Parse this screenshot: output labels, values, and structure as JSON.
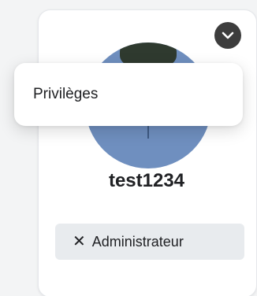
{
  "dropdown": {
    "items": [
      {
        "label": "Privilèges"
      }
    ]
  },
  "user": {
    "name": "test1234",
    "role_chip": {
      "remove_glyph": "✕",
      "label": "Administrateur"
    }
  },
  "icons": {
    "menu_toggle": "chevron-down-icon",
    "chip_remove": "close-icon"
  },
  "colors": {
    "avatar_bg": "#6f8fbf",
    "toggle_bg": "#3d3d3d",
    "chip_bg": "#e8ebee"
  }
}
